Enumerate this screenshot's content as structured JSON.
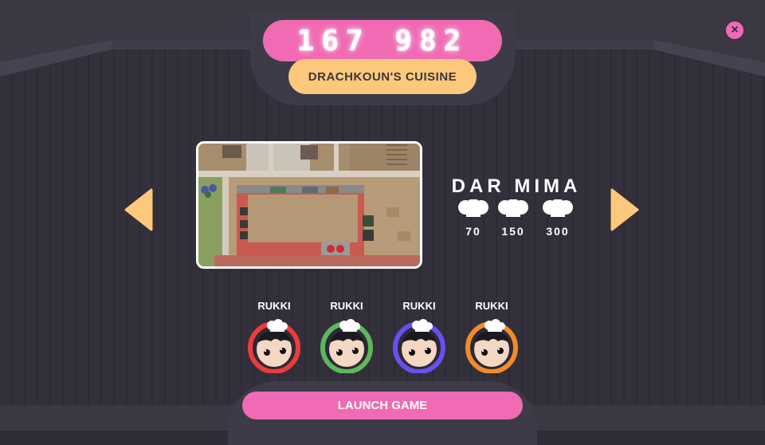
{
  "header": {
    "score": "167 982",
    "restaurant_name": "DRACHKOUN'S CUISINE",
    "close_icon": "close-icon",
    "close_label": "×"
  },
  "level": {
    "name": "DAR MIMA",
    "thresholds": [
      "70",
      "150",
      "300"
    ],
    "prev_icon": "arrow-left-icon",
    "next_icon": "arrow-right-icon"
  },
  "players": [
    {
      "name": "RUKKI",
      "color": "#ee3b3b"
    },
    {
      "name": "RUKKI",
      "color": "#5cb85c"
    },
    {
      "name": "RUKKI",
      "color": "#6a4ff0"
    },
    {
      "name": "RUKKI",
      "color": "#f58a2c"
    }
  ],
  "launch": {
    "label": "LAUNCH GAME"
  },
  "colors": {
    "accent_pink": "#f06ab4",
    "accent_orange": "#fcc97c",
    "background": "#2f2c37"
  }
}
